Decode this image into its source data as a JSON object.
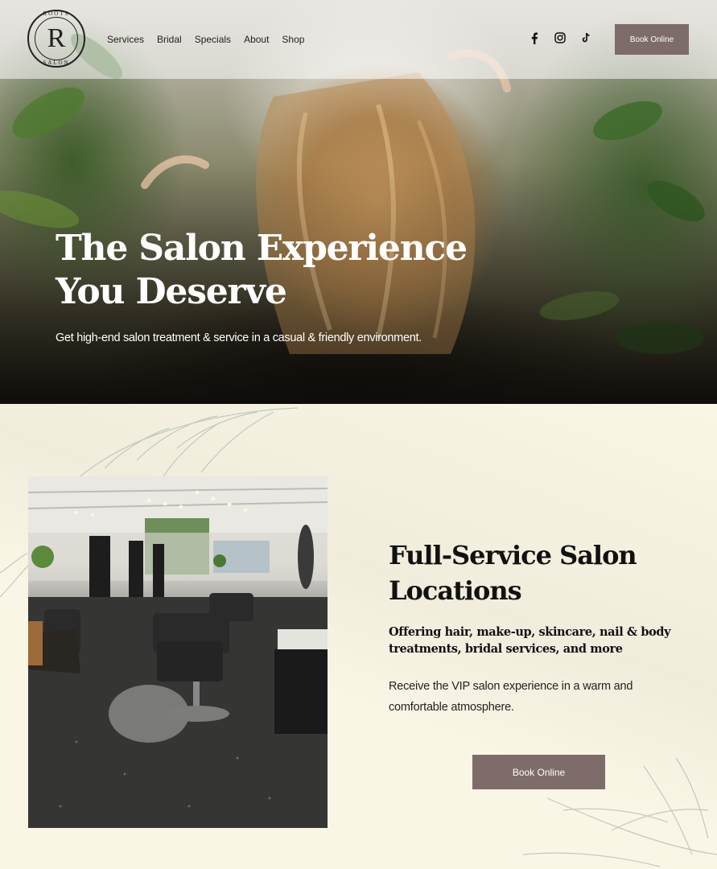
{
  "nav": {
    "logo_letter": "R",
    "logo_top_text": "ROOTS",
    "logo_bottom_text": "SALON",
    "links": [
      "Services",
      "Bridal",
      "Specials",
      "About",
      "Shop"
    ],
    "social_icons": [
      "facebook-icon",
      "instagram-icon",
      "tiktok-icon"
    ],
    "book_label": "Book Online"
  },
  "hero": {
    "title": "The Salon Experience You Deserve",
    "subtitle": "Get high-end salon treatment & service in a casual & friendly environment."
  },
  "section": {
    "title": "Full-Service Salon Locations",
    "subtitle": "Offering hair, make-up, skincare, nail & body treatments, bridal services, and more",
    "body": "Receive the  VIP salon experience in a warm and comfortable atmosphere.",
    "book_label": "Book Online"
  },
  "colors": {
    "button": "#7d6c6a",
    "background": "#faf6e6",
    "text_dark": "#111111"
  }
}
